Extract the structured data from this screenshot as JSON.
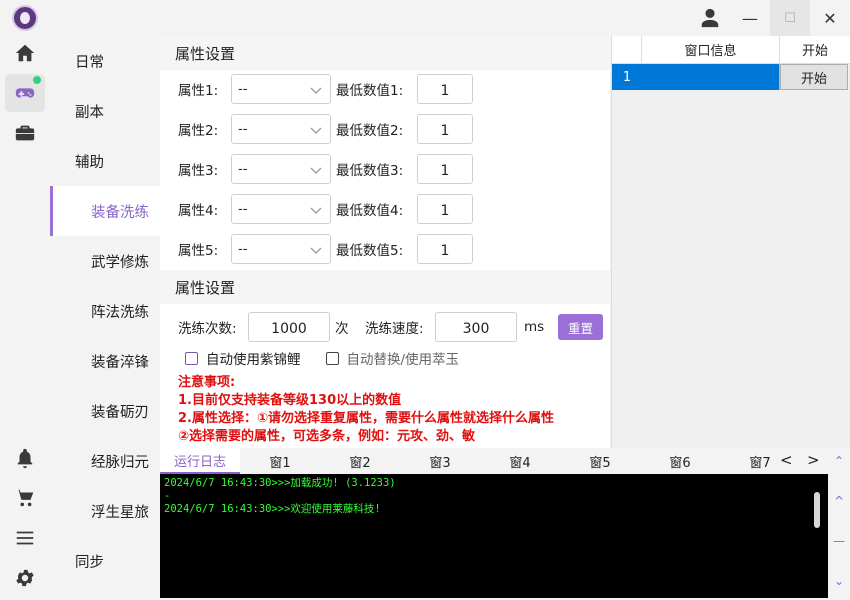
{
  "colors": {
    "accent": "#9b70d6",
    "selection": "#0078d7",
    "console_text": "#32ff32",
    "notice": "#e01010"
  },
  "rail": {
    "icons": [
      "app-logo",
      "home-icon",
      "gamepad-icon",
      "briefcase-icon",
      "bell-icon",
      "cart-icon",
      "menu-icon",
      "gear-icon"
    ]
  },
  "window": {
    "minimize": "—",
    "maximize": "☐",
    "close": "✕"
  },
  "nav": {
    "items": [
      {
        "label": "日常"
      },
      {
        "label": "副本"
      },
      {
        "label": "辅助"
      },
      {
        "label": "装备洗练"
      },
      {
        "label": "武学修炼"
      },
      {
        "label": "阵法洗练"
      },
      {
        "label": "装备淬锋"
      },
      {
        "label": "装备砺刃"
      },
      {
        "label": "经脉归元"
      },
      {
        "label": "浮生星旅"
      },
      {
        "label": "同步"
      }
    ]
  },
  "section1": {
    "title": "属性设置",
    "rows": [
      {
        "label": "属性1:",
        "select": "--",
        "min_label": "最低数值1:",
        "min_value": "1"
      },
      {
        "label": "属性2:",
        "select": "--",
        "min_label": "最低数值2:",
        "min_value": "1"
      },
      {
        "label": "属性3:",
        "select": "--",
        "min_label": "最低数值3:",
        "min_value": "1"
      },
      {
        "label": "属性4:",
        "select": "--",
        "min_label": "最低数值4:",
        "min_value": "1"
      },
      {
        "label": "属性5:",
        "select": "--",
        "min_label": "最低数值5:",
        "min_value": "1"
      }
    ]
  },
  "section2": {
    "title": "属性设置",
    "count_label": "洗练次数:",
    "count_value": "1000",
    "count_unit": "次",
    "speed_label": "洗练速度:",
    "speed_value": "300",
    "speed_unit": "ms",
    "reset_label": "重置",
    "check1": "自动使用紫锦鲤",
    "check2": "自动替换/使用萃玉"
  },
  "notice": {
    "title": "注意事项:",
    "line1": "1.目前仅支持装备等级130以上的数值",
    "line2": "2.属性选择：①请勿选择重复属性，需要什么属性就选择什么属性",
    "line3": "②选择需要的属性，可选多条，例如：元攻、劲、敏"
  },
  "wtable": {
    "col_info": "窗口信息",
    "col_start": "开始",
    "rows": [
      {
        "idx": "1",
        "button": "开始"
      }
    ]
  },
  "logtabs": {
    "tabs": [
      "运行日志",
      "窗1",
      "窗2",
      "窗3",
      "窗4",
      "窗5",
      "窗6",
      "窗7"
    ],
    "prev": "<",
    "next": ">"
  },
  "console": {
    "lines": [
      "2024/6/7 16:43:30>>>加载成功! (3.1233)",
      "-",
      "2024/6/7 16:43:30>>>欢迎使用莱藤科技!"
    ]
  }
}
